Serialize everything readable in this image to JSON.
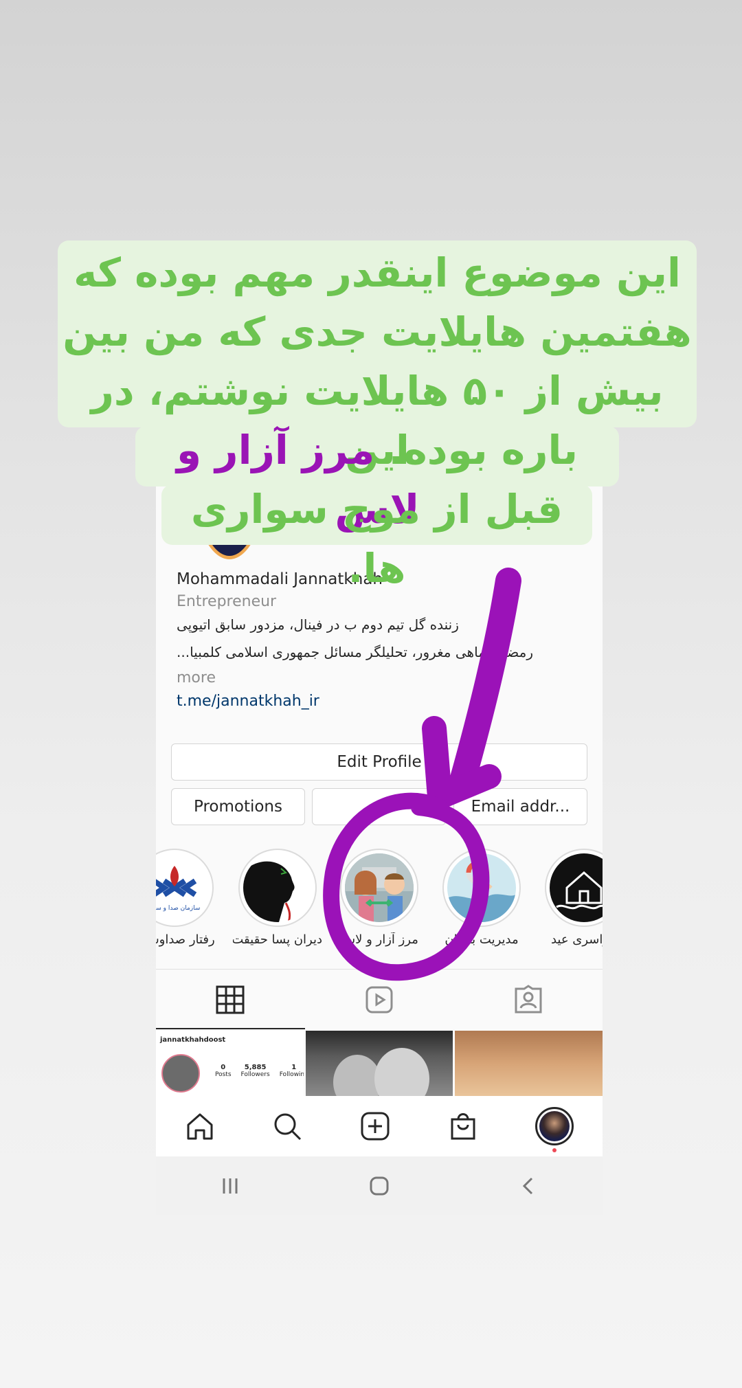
{
  "caption": {
    "line1": "این موضوع اینقدر مهم بوده که",
    "line2": "هفتمین هایلایت جدی که من بین",
    "line3": "بیش از ۵۰ هایلایت نوشتم، در این",
    "line4_a": "باره بوده.",
    "line4_b": "مرز آزار و لاس",
    "line5": "قبل از موج سواری ها.",
    "text_color": "#6dc451",
    "highlight_color": "#9a14b5",
    "background": "#e6f4df"
  },
  "profile": {
    "name": "Mohammadali Jannatkhah",
    "category": "Entrepreneur",
    "bio_line1": "زننده گل تیم دوم ب در فینال، مزدور سابق اتیوپی",
    "bio_line2": "رمضون ماهی مغرور، تحلیلگر مسائل جمهوری اسلامی کلمبیا...",
    "more": "more",
    "link": "t.me/jannatkhah_ir"
  },
  "buttons": {
    "edit_profile": "Edit Profile",
    "promotions": "Promotions",
    "middle": "",
    "email": "Email addr..."
  },
  "highlights": [
    {
      "label": "رفتار صداوسیما",
      "icon": "irib-logo-icon"
    },
    {
      "label": "دیران پسا حقیقت",
      "icon": "silhouette-icon"
    },
    {
      "label": "مرز آزار و لاس",
      "icon": "couple-icon"
    },
    {
      "label": "مدیریت بحران",
      "icon": "lifebuoy-icon"
    },
    {
      "label": "عزاسری عید",
      "icon": "flooded-house-icon"
    }
  ],
  "tabs": [
    "grid-icon",
    "reels-icon",
    "tagged-icon"
  ],
  "mini_profile": {
    "username": "jannatkhahdoost",
    "posts_value": "0",
    "posts_label": "Posts",
    "followers_value": "5,885",
    "followers_label": "Followers",
    "following_value": "1",
    "following_label": "Following"
  },
  "bottom_nav": [
    "home-icon",
    "search-icon",
    "new-post-icon",
    "shop-icon",
    "profile-avatar"
  ],
  "system_nav": [
    "recents-icon",
    "home-circle-icon",
    "back-icon"
  ],
  "annotation_color": "#9b12b8"
}
